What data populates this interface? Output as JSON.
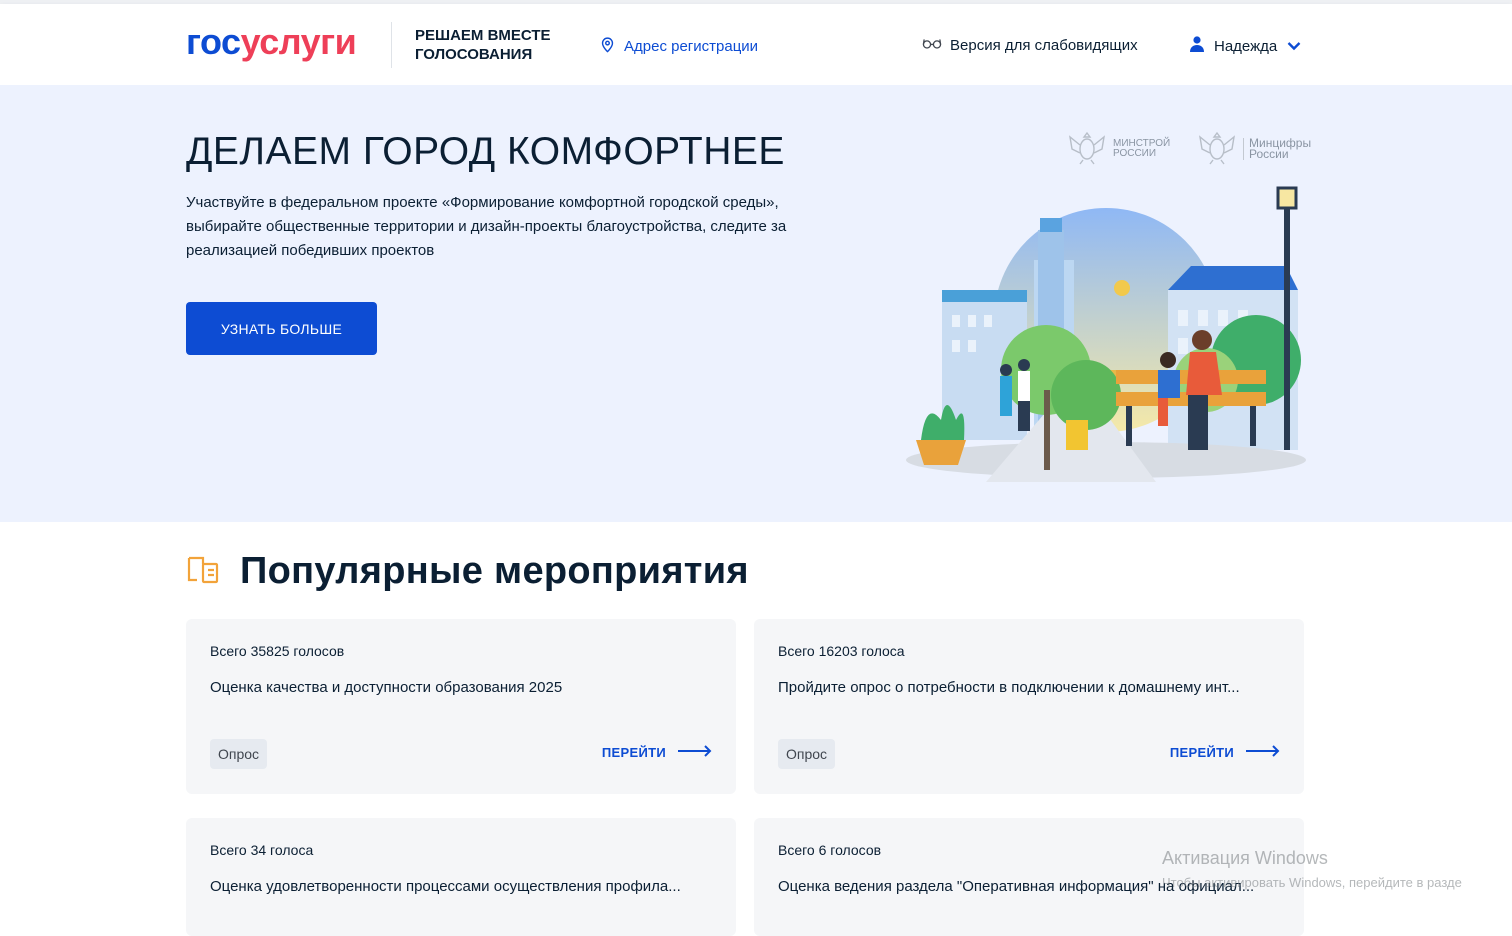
{
  "header": {
    "logo_part1": "гос",
    "logo_part2": "услуги",
    "project_title": "РЕШАЕМ ВМЕСТЕ ГОЛОСОВАНИЯ",
    "address_link": "Адрес регистрации",
    "impaired_version": "Версия для слабовидящих",
    "user_name": "Надежда"
  },
  "hero": {
    "title": "ДЕЛАЕМ ГОРОД КОМФОРТНЕЕ",
    "description": "Участвуйте в федеральном проекте «Формирование комфортной городской среды», выбирайте общественные территории и дизайн-проекты благоустройства, следите за реализацией победивших проектов",
    "button": "УЗНАТЬ БОЛЬШЕ",
    "ministry1_line1": "МИНСТРОЙ",
    "ministry1_line2": "РОССИИ",
    "ministry2_line1": "Минцифры",
    "ministry2_line2": "России"
  },
  "popular": {
    "title": "Популярные мероприятия",
    "cards": [
      {
        "votes": "Всего 35825 голосов",
        "title": "Оценка качества и доступности образования 2025",
        "tag": "Опрос",
        "action": "ПЕРЕЙТИ"
      },
      {
        "votes": "Всего 16203 голоса",
        "title": "Пройдите опрос о потребности в подключении к домашнему инт...",
        "tag": "Опрос",
        "action": "ПЕРЕЙТИ"
      },
      {
        "votes": "Всего 34 голоса",
        "title": "Оценка удовлетворенности процессами осуществления профила..."
      },
      {
        "votes": "Всего 6 голосов",
        "title": "Оценка ведения раздела \"Оперативная информация\" на официал..."
      }
    ]
  },
  "watermark": {
    "line1": "Активация Windows",
    "line2": "Чтобы активировать Windows, перейдите в разде"
  },
  "colors": {
    "primary": "#0d4cd3",
    "logo_red": "#ee3f58",
    "hero_bg": "#edf2fe",
    "card_bg": "#f5f6f8",
    "text": "#0b1f33"
  }
}
